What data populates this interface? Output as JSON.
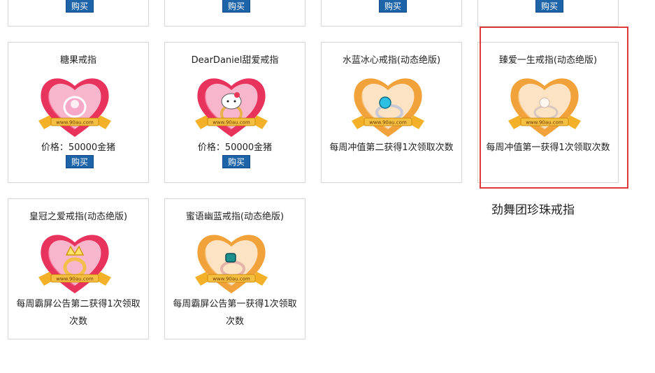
{
  "top_row": {
    "buy_label": "购买"
  },
  "cards": [
    {
      "title": "糖果戒指",
      "price": "价格：50000金猪",
      "buy": "购买",
      "watermark": "www.90au.com",
      "theme": "pink",
      "ring": "pink-candy"
    },
    {
      "title": "DearDaniel甜爱戒指",
      "price": "价格：50000金猪",
      "buy": "购买",
      "watermark": "www.90au.com",
      "theme": "pink",
      "ring": "kitty"
    },
    {
      "title": "水蓝冰心戒指(动态绝版)",
      "desc": "每周冲值第二获得1次领取次数",
      "watermark": "www.90au.com",
      "theme": "orange",
      "ring": "blue-gem"
    },
    {
      "title": "臻爱一生戒指(动态绝版)",
      "desc": "每周冲值第一获得1次领取次数",
      "watermark": "www.90au.com",
      "theme": "orange",
      "ring": "pearl"
    },
    {
      "title": "皇冠之爱戒指(动态绝版)",
      "desc": "每周霸屏公告第二获得1次领取次数",
      "watermark": "www.90au.com",
      "theme": "pink",
      "ring": "crown"
    },
    {
      "title": "蜜语幽蓝戒指(动态绝版)",
      "desc": "每周霸屏公告第一获得1次领取次数",
      "watermark": "www.90au.com",
      "theme": "orange",
      "ring": "teal-gem"
    }
  ],
  "caption": "劲舞团珍珠戒指",
  "colors": {
    "buy_button": "#1c63a8",
    "highlight_border": "#e0393b",
    "card_border": "#d6d6d6"
  }
}
